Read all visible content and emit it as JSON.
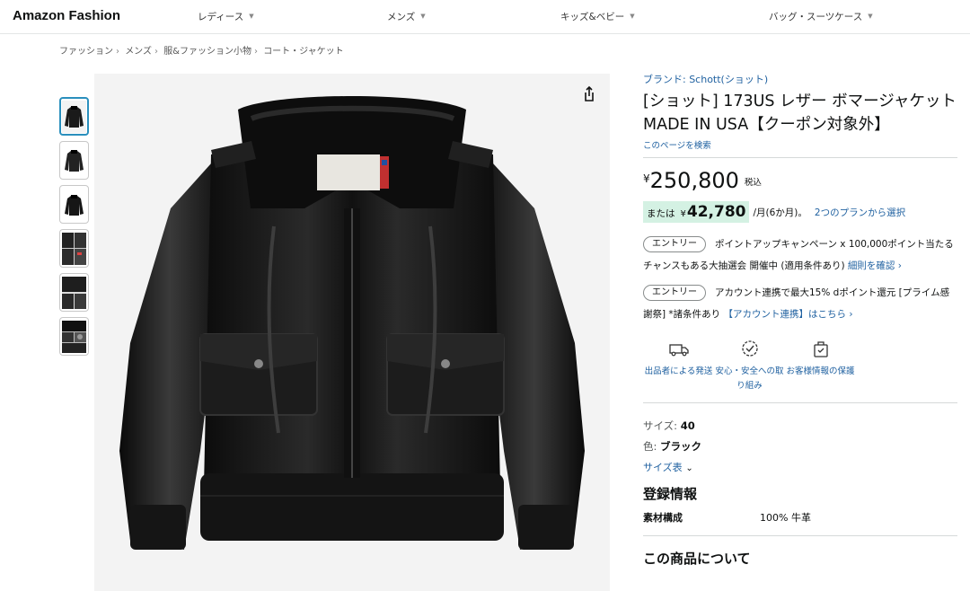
{
  "nav": {
    "logo": "Amazon Fashion",
    "items": [
      "レディース",
      "メンズ",
      "キッズ&ベビー",
      "バッグ・スーツケース"
    ]
  },
  "breadcrumb": [
    "ファッション",
    "メンズ",
    "服&ファッション小物",
    "コート・ジャケット"
  ],
  "gallery": {
    "thumbnail_count": 6,
    "active_index": 0
  },
  "product": {
    "brand": "ブランド: Schott(ショット)",
    "title": "[ショット] 173US レザー ボマージャケット MADE IN USA【クーポン対象外】",
    "search_link": "このページを検索",
    "price_symbol": "¥",
    "price": "250,800",
    "price_tax": "税込",
    "installment_label": "または",
    "installment_symbol": "¥",
    "installment_amount": "42,780",
    "installment_period": "/月(6か月)。",
    "installment_link": "2つのプランから選択",
    "promos": [
      {
        "pill": "エントリー",
        "text": "ポイントアップキャンペーン x 100,000ポイント当たるチャンスもある大抽選会 開催中 (適用条件あり)",
        "link": "細則を確認 ›"
      },
      {
        "pill": "エントリー",
        "text": "アカウント連携で最大15% dポイント還元 [プライム感謝祭] *諸条件あり",
        "link": "【アカウント連携】はこちら ›"
      }
    ],
    "trust": [
      {
        "label": "出品者による発送",
        "icon": "truck-icon"
      },
      {
        "label": "安心・安全への取り組み",
        "icon": "shield-badge-icon"
      },
      {
        "label": "お客様情報の保護",
        "icon": "lock-bag-icon"
      }
    ],
    "size_label": "サイズ: ",
    "size_value": "40",
    "color_label": "色: ",
    "color_value": "ブラック",
    "size_chart": "サイズ表",
    "registration_title": "登録情報",
    "spec_key": "素材構成",
    "spec_value": "100% 牛革",
    "about_title": "この商品について"
  },
  "colors": {
    "link": "#2162a1",
    "install_highlight": "#d4f1e3",
    "active_thumb": "#2a8fbd"
  }
}
